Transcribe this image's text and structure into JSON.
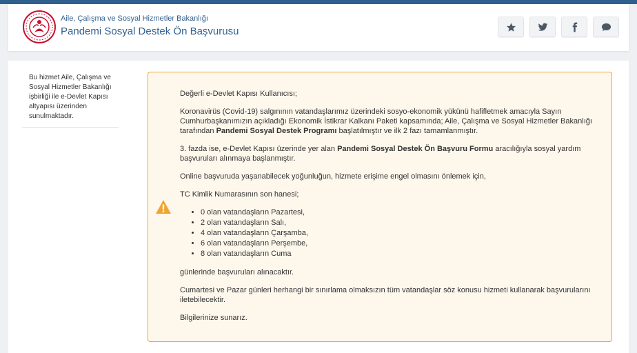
{
  "header": {
    "org_name": "Aile, Çalışma ve Sosyal Hizmetler Bakanlığı",
    "service_title": "Pandemi Sosyal Destek Ön Başvurusu",
    "actions": [
      {
        "name": "favorite",
        "icon": "star-icon"
      },
      {
        "name": "twitter",
        "icon": "twitter-icon"
      },
      {
        "name": "facebook",
        "icon": "facebook-icon"
      },
      {
        "name": "comment",
        "icon": "comment-icon"
      }
    ]
  },
  "sidebar": {
    "info": "Bu hizmet Aile, Çalışma ve Sosyal Hizmetler Bakanlığı işbirliği ile e-Devlet Kapısı altyapısı üzerinden sunulmaktadır."
  },
  "notice": {
    "icon": "warning-icon",
    "greeting": "Değerli e-Devlet Kapısı Kullanıcısı;",
    "p1_a": "Koronavirüs (Covid-19) salgınının vatandaşlarımız üzerindeki sosyo-ekonomik yükünü hafifletmek amacıyla Sayın Cumhurbaşkanımızın açıkladığı Ekonomik İstikrar Kalkanı Paketi kapsamında; Aile, Çalışma ve Sosyal Hizmetler Bakanlığı tarafından ",
    "p1_b": "Pandemi Sosyal Destek Programı",
    "p1_c": " başlatılmıştır ve ilk 2 fazı tamamlanmıştır.",
    "p2_a": "3. fazda ise, e-Devlet Kapısı üzerinde yer alan ",
    "p2_b": "Pandemi Sosyal Destek Ön Başvuru Formu",
    "p2_c": " aracılığıyla sosyal yardım başvuruları alınmaya başlanmıştır.",
    "p3": "Online başvuruda yaşanabilecek yoğunluğun, hizmete erişime engel olmasını önlemek için,",
    "p4": "TC Kimlik Numarasının son hanesi;",
    "days": [
      "0 olan vatandaşların Pazartesi,",
      "2 olan vatandaşların Salı,",
      "4 olan vatandaşların Çarşamba,",
      "6 olan vatandaşların Perşembe,",
      "8 olan vatandaşların Cuma"
    ],
    "p5": "günlerinde başvuruları alınacaktır.",
    "p6": "Cumartesi ve Pazar günleri herhangi bir sınırlama olmaksızın tüm vatandaşlar söz konusu hizmeti kullanarak başvurularını iletebilecektir.",
    "p7": "Bilgilerinize sunarız."
  },
  "colors": {
    "brand": "#2f5f8f",
    "logo_red": "#c8102e",
    "alert_border": "#f0a431",
    "alert_bg": "#fdf7ec",
    "warning": "#f0a431"
  }
}
